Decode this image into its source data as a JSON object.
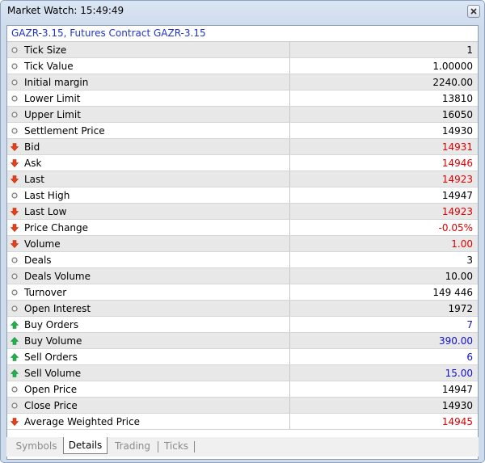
{
  "window": {
    "title": "Market Watch: 15:49:49"
  },
  "header": {
    "symbol_label": "GAZR-3.15, Futures Contract GAZR-3.15"
  },
  "colors": {
    "red": "#e00000",
    "blue": "#1010d0",
    "up_arrow": "#22b14c",
    "down_arrow": "#e8401a"
  },
  "rows": [
    {
      "label": "Tick Size",
      "value": "1",
      "icon": "circle-icon",
      "color": "black"
    },
    {
      "label": "Tick Value",
      "value": "1.00000",
      "icon": "circle-icon",
      "color": "black"
    },
    {
      "label": "Initial margin",
      "value": "2240.00",
      "icon": "circle-icon",
      "color": "black"
    },
    {
      "label": "Lower Limit",
      "value": "13810",
      "icon": "circle-icon",
      "color": "black"
    },
    {
      "label": "Upper Limit",
      "value": "16050",
      "icon": "circle-icon",
      "color": "black"
    },
    {
      "label": "Settlement Price",
      "value": "14930",
      "icon": "circle-icon",
      "color": "black"
    },
    {
      "label": "Bid",
      "value": "14931",
      "icon": "arrow-down-icon",
      "color": "red"
    },
    {
      "label": "Ask",
      "value": "14946",
      "icon": "arrow-down-icon",
      "color": "red"
    },
    {
      "label": "Last",
      "value": "14923",
      "icon": "arrow-down-icon",
      "color": "red"
    },
    {
      "label": "Last High",
      "value": "14947",
      "icon": "circle-icon",
      "color": "black"
    },
    {
      "label": "Last Low",
      "value": "14923",
      "icon": "arrow-down-icon",
      "color": "red"
    },
    {
      "label": "Price Change",
      "value": "-0.05%",
      "icon": "arrow-down-icon",
      "color": "red"
    },
    {
      "label": "Volume",
      "value": "1.00",
      "icon": "arrow-down-icon",
      "color": "red"
    },
    {
      "label": "Deals",
      "value": "3",
      "icon": "circle-icon",
      "color": "black"
    },
    {
      "label": "Deals Volume",
      "value": "10.00",
      "icon": "circle-icon",
      "color": "black"
    },
    {
      "label": "Turnover",
      "value": "149 446",
      "icon": "circle-icon",
      "color": "black"
    },
    {
      "label": "Open Interest",
      "value": "1972",
      "icon": "circle-icon",
      "color": "black"
    },
    {
      "label": "Buy Orders",
      "value": "7",
      "icon": "arrow-up-icon",
      "color": "blue"
    },
    {
      "label": "Buy Volume",
      "value": "390.00",
      "icon": "arrow-up-icon",
      "color": "blue"
    },
    {
      "label": "Sell Orders",
      "value": "6",
      "icon": "arrow-up-icon",
      "color": "blue"
    },
    {
      "label": "Sell Volume",
      "value": "15.00",
      "icon": "arrow-up-icon",
      "color": "blue"
    },
    {
      "label": "Open Price",
      "value": "14947",
      "icon": "circle-icon",
      "color": "black"
    },
    {
      "label": "Close Price",
      "value": "14930",
      "icon": "circle-icon",
      "color": "black"
    },
    {
      "label": "Average Weighted Price",
      "value": "14945",
      "icon": "arrow-down-icon",
      "color": "red"
    }
  ],
  "tabs": [
    {
      "label": "Symbols",
      "active": false
    },
    {
      "label": "Details",
      "active": true
    },
    {
      "label": "Trading",
      "active": false
    },
    {
      "label": "Ticks",
      "active": false
    }
  ]
}
